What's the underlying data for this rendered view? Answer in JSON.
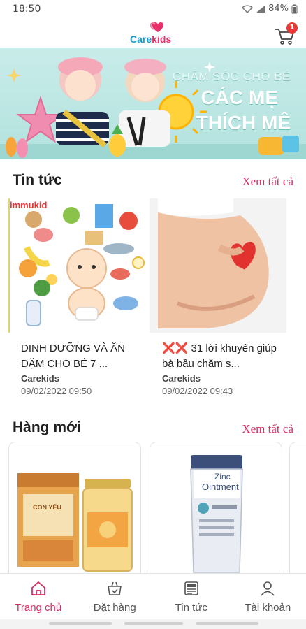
{
  "status_bar": {
    "time": "18:50",
    "battery": "84%"
  },
  "header": {
    "logo_part1": "Care",
    "logo_part2": "kids",
    "cart_count": "1"
  },
  "banner": {
    "line1": "CHĂM SÓC CHO BÉ",
    "line2": "CÁC MẸ",
    "line3": "THÍCH MÊ"
  },
  "news_section": {
    "title": "Tin tức",
    "see_all": "Xem tất cả",
    "items": [
      {
        "brand_overlay": "immukid",
        "title": "DINH DƯỠNG VÀ ĂN DẶM CHO BÉ 7 ...",
        "source": "Carekids",
        "date": "09/02/2022 09:50"
      },
      {
        "title": "❌❌ 31 lời khuyên giúp bà bầu chăm s...",
        "source": "Carekids",
        "date": "09/02/2022 09:43"
      }
    ]
  },
  "new_products_section": {
    "title": "Hàng mới",
    "see_all": "Xem tất cả",
    "products": [
      {
        "box_label": "CON YẾU"
      },
      {
        "tube_label_1": "Zinc",
        "tube_label_2": "Ointment"
      }
    ]
  },
  "bottom_nav": {
    "items": [
      {
        "label": "Trang chủ",
        "icon": "home-icon",
        "active": true
      },
      {
        "label": "Đặt hàng",
        "icon": "basket-icon",
        "active": false
      },
      {
        "label": "Tin tức",
        "icon": "news-icon",
        "active": false
      },
      {
        "label": "Tài khoản",
        "icon": "user-icon",
        "active": false
      }
    ]
  },
  "colors": {
    "accent": "#d62f62",
    "logo_blue": "#1a9bd7",
    "logo_pink": "#e8316b",
    "banner_bg": "#c8ece9"
  }
}
